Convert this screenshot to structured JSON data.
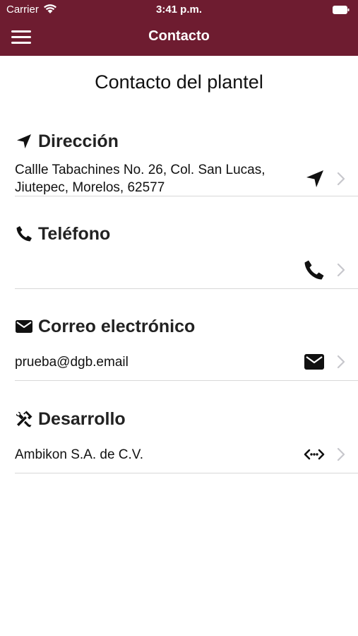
{
  "status_bar": {
    "carrier": "Carrier",
    "time": "3:41 p.m."
  },
  "nav": {
    "title": "Contacto",
    "menu_icon": "hamburger-menu-icon"
  },
  "page": {
    "heading": "Contacto del plantel"
  },
  "sections": [
    {
      "title": "Dirección",
      "icon": "location-arrow-icon",
      "value": "Callle Tabachines No. 26, Col. San Lucas, Jiutepec, Morelos, 62577",
      "action_icon": "location-arrow-icon"
    },
    {
      "title": "Teléfono",
      "icon": "phone-icon",
      "value": "",
      "action_icon": "phone-icon"
    },
    {
      "title": "Correo electrónico",
      "icon": "envelope-icon",
      "value": "prueba@dgb.email",
      "action_icon": "envelope-icon"
    },
    {
      "title": "Desarrollo",
      "icon": "tools-icon",
      "value": "Ambikon S.A. de C.V.",
      "action_icon": "code-arrows-icon"
    }
  ],
  "colors": {
    "header_bg": "#6e1c30",
    "text": "#111111",
    "chevron": "#c7c7cc",
    "divider": "#d8d8d8"
  }
}
